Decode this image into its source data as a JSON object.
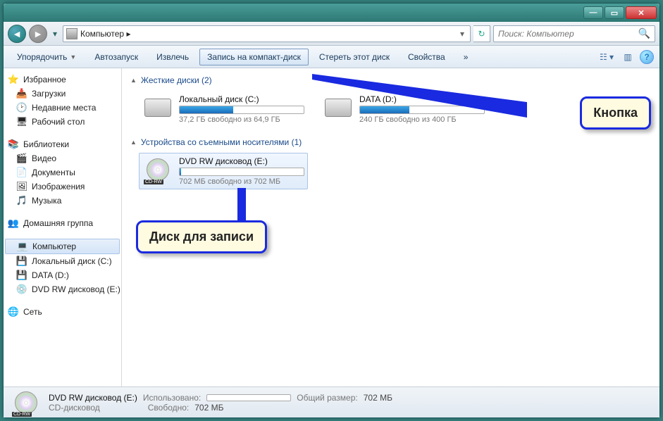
{
  "address": {
    "path": "Компьютер ▸"
  },
  "search": {
    "placeholder": "Поиск: Компьютер"
  },
  "toolbar": {
    "organize": "Упорядочить",
    "autoplay": "Автозапуск",
    "eject": "Извлечь",
    "burn": "Запись на компакт-диск",
    "erase": "Стереть этот диск",
    "properties": "Свойства"
  },
  "sidebar": {
    "favorites": {
      "label": "Избранное",
      "items": [
        "Загрузки",
        "Недавние места",
        "Рабочий стол"
      ]
    },
    "libraries": {
      "label": "Библиотеки",
      "items": [
        "Видео",
        "Документы",
        "Изображения",
        "Музыка"
      ]
    },
    "homegroup": "Домашняя группа",
    "computer": {
      "label": "Компьютер",
      "items": [
        "Локальный диск (C:)",
        "DATA (D:)",
        "DVD RW дисковод (E:)"
      ]
    },
    "network": "Сеть"
  },
  "sections": {
    "hdd": {
      "title": "Жесткие диски (2)"
    },
    "removable": {
      "title": "Устройства со съемными носителями (1)"
    }
  },
  "drives": {
    "c": {
      "name": "Локальный диск (C:)",
      "free": "37,2 ГБ свободно из 64,9 ГБ",
      "pct": 43
    },
    "d": {
      "name": "DATA (D:)",
      "free": "240 ГБ свободно из 400 ГБ",
      "pct": 40
    },
    "e": {
      "name": "DVD RW дисковод (E:)",
      "free": "702 МБ свободно из 702 МБ",
      "pct": 1
    }
  },
  "status": {
    "title": "DVD RW дисковод (E:)",
    "type": "CD-дисковод",
    "used_lbl": "Использовано:",
    "free_lbl": "Свободно:",
    "free_val": "702 МБ",
    "total_lbl": "Общий размер:",
    "total_val": "702 МБ"
  },
  "callouts": {
    "button": "Кнопка",
    "disc": "Диск для записи"
  }
}
